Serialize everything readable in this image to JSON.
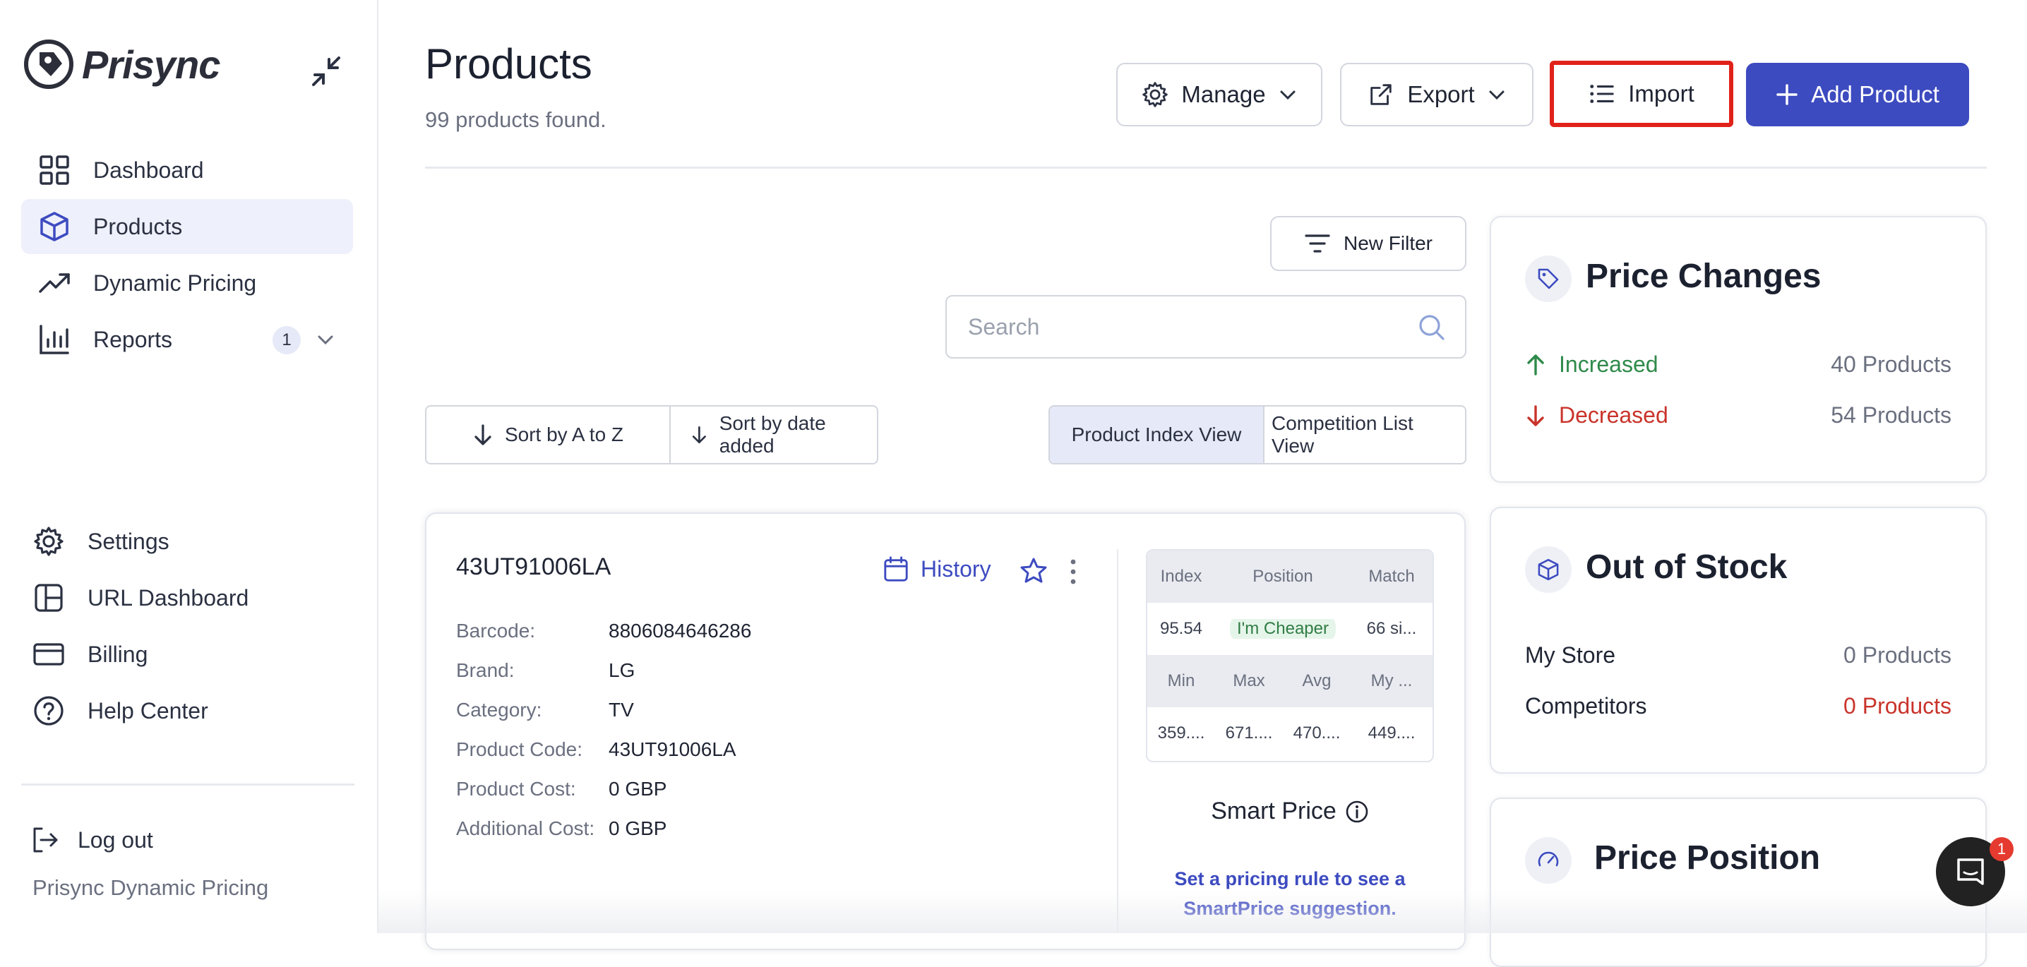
{
  "sidebar": {
    "brand": "Prisync",
    "items": [
      {
        "label": "Dashboard",
        "icon": "grid-icon"
      },
      {
        "label": "Products",
        "icon": "cube-icon",
        "active": true
      },
      {
        "label": "Dynamic Pricing",
        "icon": "trending-up-icon"
      },
      {
        "label": "Reports",
        "icon": "bar-chart-icon",
        "badge": "1"
      }
    ],
    "bottom_items": [
      {
        "label": "Settings",
        "icon": "gear-icon"
      },
      {
        "label": "URL Dashboard",
        "icon": "layout-icon"
      },
      {
        "label": "Billing",
        "icon": "credit-card-icon"
      },
      {
        "label": "Help Center",
        "icon": "help-circle-icon"
      }
    ],
    "logout": "Log out",
    "footer": "Prisync Dynamic Pricing"
  },
  "header": {
    "title": "Products",
    "subtitle": "99 products found.",
    "manage": "Manage",
    "export": "Export",
    "import": "Import",
    "add_product": "Add Product"
  },
  "filters": {
    "new_filter": "New Filter",
    "search_placeholder": "Search",
    "sort_az": "Sort by A to Z",
    "sort_date": "Sort by date added",
    "view_index": "Product Index View",
    "view_competition": "Competition List View"
  },
  "product": {
    "sku": "43UT91006LA",
    "history": "History",
    "fields": [
      {
        "label": "Barcode:",
        "value": "8806084646286"
      },
      {
        "label": "Brand:",
        "value": "LG"
      },
      {
        "label": "Category:",
        "value": "TV"
      },
      {
        "label": "Product Code:",
        "value": "43UT91006LA"
      },
      {
        "label": "Product Cost:",
        "value": "0 GBP"
      },
      {
        "label": "Additional Cost:",
        "value": "0 GBP"
      }
    ],
    "metrics": {
      "h1": [
        "Index",
        "Position",
        "Match"
      ],
      "v1": [
        "95.54",
        "I'm Cheaper",
        "66 si..."
      ],
      "h2": [
        "Min",
        "Max",
        "Avg",
        "My ..."
      ],
      "v2": [
        "359....",
        "671....",
        "470....",
        "449...."
      ]
    },
    "smart_price": "Smart Price",
    "smart_note": "Set a pricing rule to see a SmartPrice suggestion."
  },
  "widgets": {
    "price_changes": {
      "title": "Price Changes",
      "increased_label": "Increased",
      "increased_value": "40 Products",
      "decreased_label": "Decreased",
      "decreased_value": "54 Products"
    },
    "out_of_stock": {
      "title": "Out of Stock",
      "store_label": "My Store",
      "store_value": "0 Products",
      "comp_label": "Competitors",
      "comp_value": "0 Products"
    },
    "price_position": {
      "title": "Price Position"
    }
  },
  "chat_badge": "1",
  "colors": {
    "accent": "#3d4bc0",
    "highlight": "#e0221a",
    "green": "#2f8a4a",
    "red": "#c9342b"
  }
}
